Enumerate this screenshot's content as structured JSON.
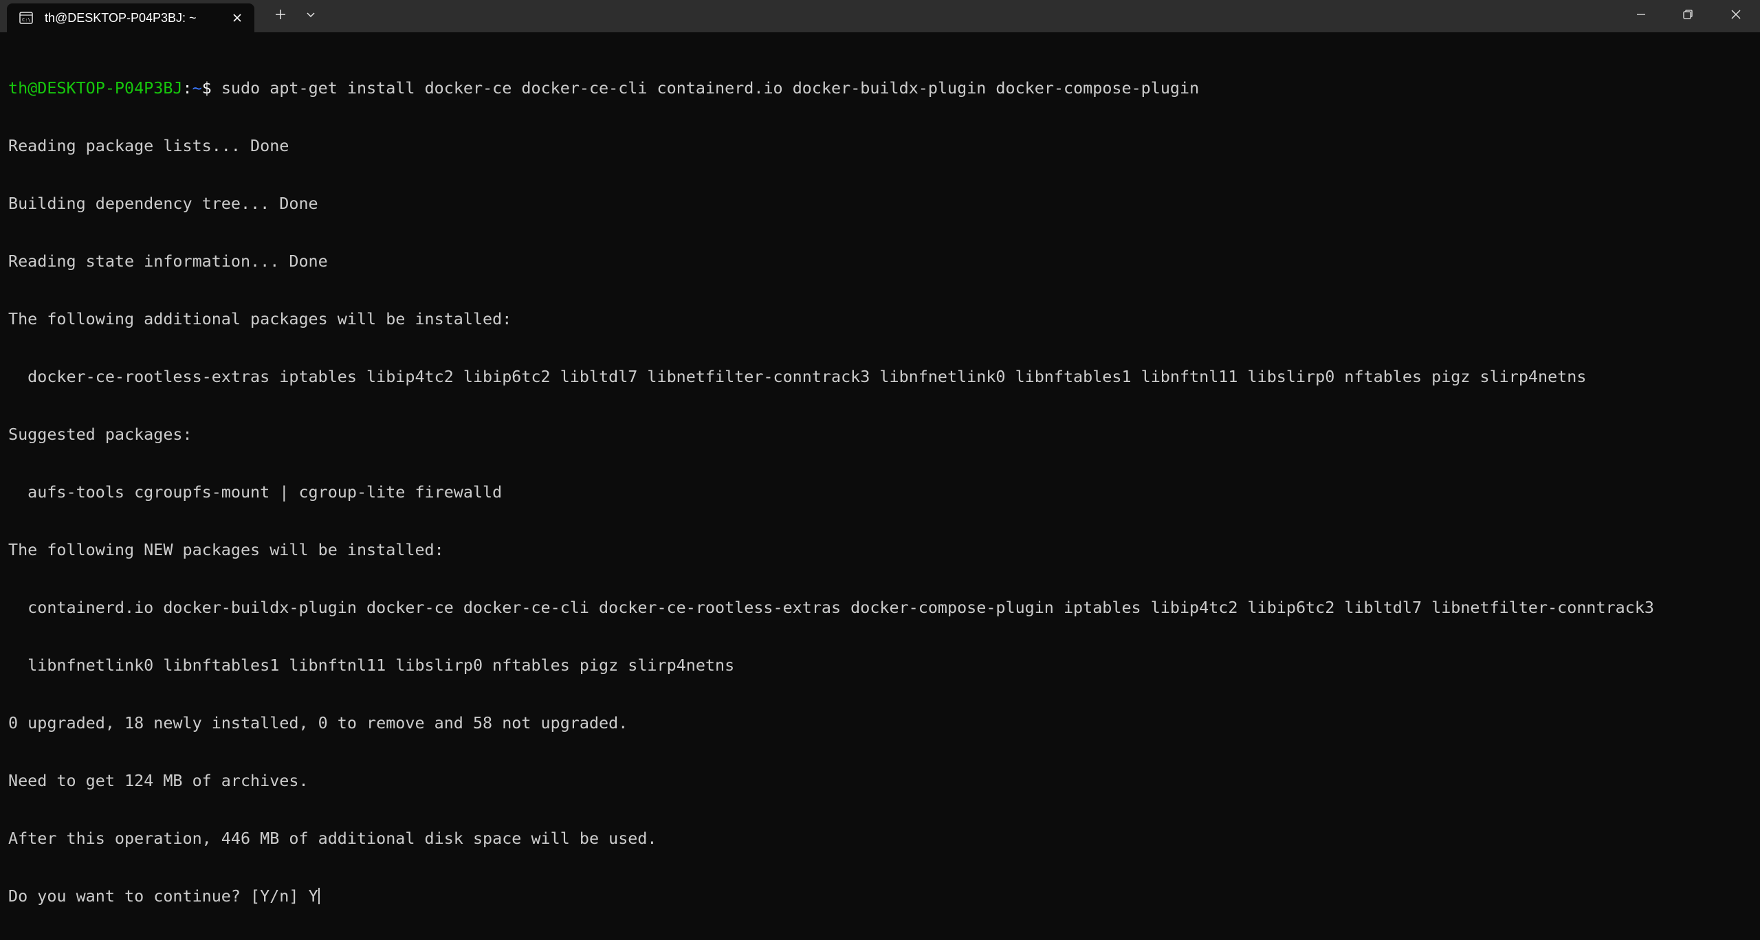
{
  "window": {
    "tab_title": "th@DESKTOP-P04P3BJ: ~",
    "tab_icon": "terminal-icon",
    "controls": [
      "new-tab-icon",
      "chevron-down-icon",
      "minimize-icon",
      "maximize-icon",
      "close-icon"
    ]
  },
  "terminal": {
    "prompt": {
      "user_host": "th@DESKTOP-P04P3BJ",
      "colon": ":",
      "path": "~",
      "symbol": "$",
      "command": " sudo apt-get install docker-ce docker-ce-cli containerd.io docker-buildx-plugin docker-compose-plugin"
    },
    "lines": [
      "Reading package lists... Done",
      "Building dependency tree... Done",
      "Reading state information... Done",
      "The following additional packages will be installed:",
      "  docker-ce-rootless-extras iptables libip4tc2 libip6tc2 libltdl7 libnetfilter-conntrack3 libnfnetlink0 libnftables1 libnftnl11 libslirp0 nftables pigz slirp4netns",
      "Suggested packages:",
      "  aufs-tools cgroupfs-mount | cgroup-lite firewalld",
      "The following NEW packages will be installed:",
      "  containerd.io docker-buildx-plugin docker-ce docker-ce-cli docker-ce-rootless-extras docker-compose-plugin iptables libip4tc2 libip6tc2 libltdl7 libnetfilter-conntrack3",
      "  libnfnetlink0 libnftables1 libnftnl11 libslirp0 nftables pigz slirp4netns",
      "0 upgraded, 18 newly installed, 0 to remove and 58 not upgraded.",
      "Need to get 124 MB of archives.",
      "After this operation, 446 MB of additional disk space will be used."
    ],
    "input_prompt": "Do you want to continue? [Y/n] ",
    "input_value": "Y"
  },
  "colors": {
    "background": "#0c0c0c",
    "titlebar": "#2e2e2e",
    "text": "#cccccc",
    "prompt_user": "#16c60c",
    "prompt_path": "#3b78ff"
  }
}
